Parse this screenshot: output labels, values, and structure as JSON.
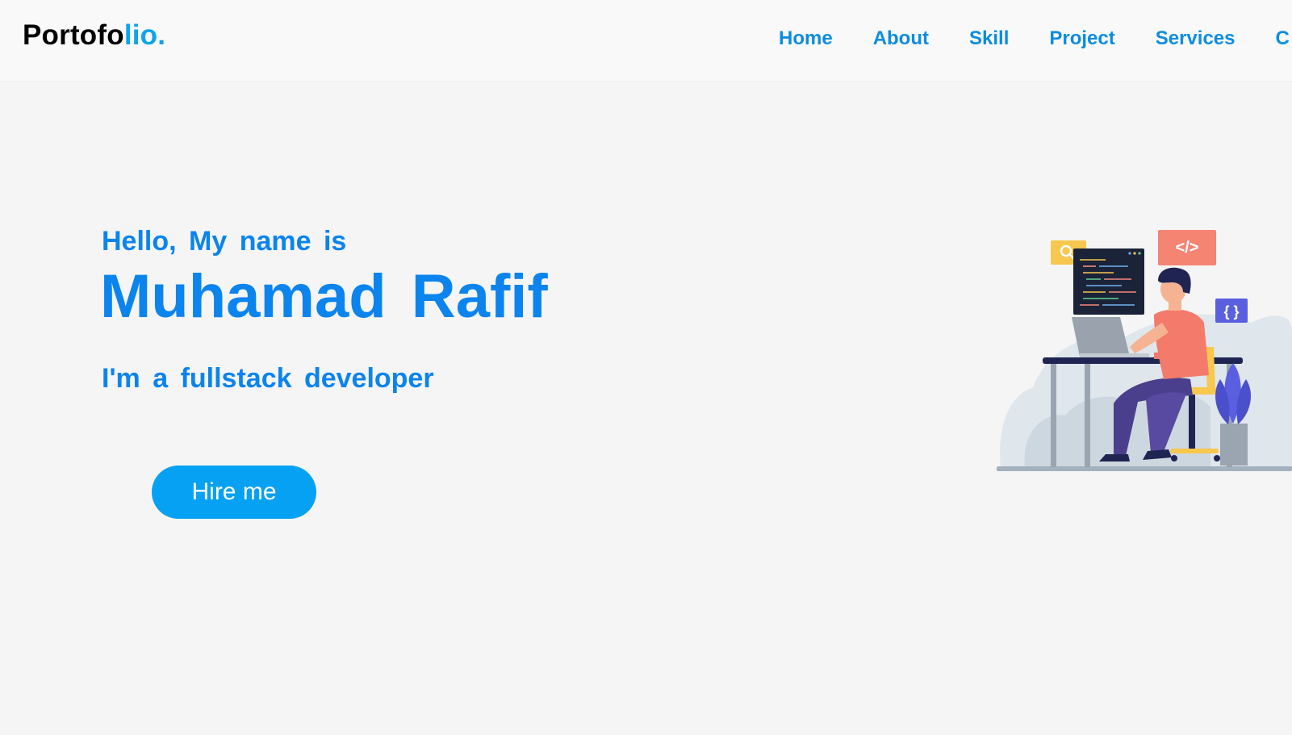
{
  "logo": {
    "main": "Portofo",
    "accent": "lio."
  },
  "nav": {
    "items": [
      {
        "label": "Home"
      },
      {
        "label": "About"
      },
      {
        "label": "Skill"
      },
      {
        "label": "Project"
      },
      {
        "label": "Services"
      },
      {
        "label": "C"
      }
    ]
  },
  "hero": {
    "greeting": "Hello, My name is",
    "name": "Muhamad Rafif",
    "role": "I'm a fullstack developer",
    "cta_label": "Hire me"
  },
  "illustration": {
    "search_icon": "search-icon",
    "code_tag_text": "</>",
    "braces_text": "{ }"
  },
  "colors": {
    "accent": "#0b84ee",
    "nav_link": "#0b8de0",
    "button": "#06a1f2",
    "logo_accent": "#0ea5ea"
  }
}
